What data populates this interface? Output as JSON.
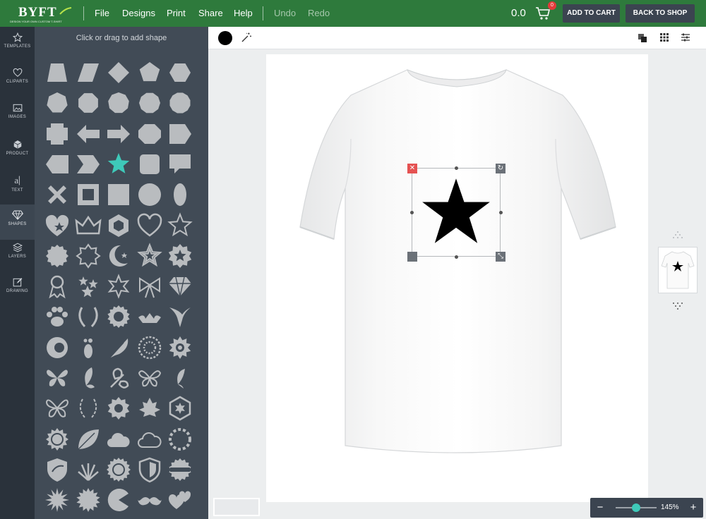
{
  "brand": {
    "name": "BYFT",
    "tagline": "DESIGN YOUR OWN CUSTOM T-SHIRT"
  },
  "menu": [
    "File",
    "Designs",
    "Print",
    "Share",
    "Help"
  ],
  "history": {
    "undo": "Undo",
    "redo": "Redo"
  },
  "cart": {
    "total": "0.0",
    "count": "0",
    "add_label": "ADD TO CART",
    "back_label": "BACK TO SHOP"
  },
  "sidebar": {
    "items": [
      {
        "label": "TEMPLATES",
        "icon": "star-outline-icon"
      },
      {
        "label": "CLIPARTS",
        "icon": "heart-icon"
      },
      {
        "label": "IMAGES",
        "icon": "image-icon"
      },
      {
        "label": "PRODUCT",
        "icon": "cube-icon"
      },
      {
        "label": "TEXT",
        "icon": "text-icon"
      },
      {
        "label": "SHAPES",
        "icon": "gem-icon",
        "active": true
      },
      {
        "label": "LAYERS",
        "icon": "layers-icon"
      },
      {
        "label": "DRAWING",
        "icon": "pencil-icon"
      }
    ]
  },
  "shapes": {
    "hint": "Click or drag to add shape",
    "items": [
      "trapezoid",
      "parallelogram",
      "diamond",
      "pentagon",
      "hexagon",
      "heptagon",
      "octagon",
      "nonagon",
      "decagon",
      "dodecagon",
      "cross",
      "arrow-left",
      "arrow-right",
      "octagon-wide",
      "pentagon-right",
      "chevron-left",
      "chevron-right",
      "star",
      "square-rounded",
      "speech-bubble",
      "x-mark",
      "square-frame",
      "square",
      "circle",
      "ellipse",
      "heart-star",
      "crown",
      "hexagon-ring",
      "heart-outline",
      "star-outline",
      "badge-scallop",
      "starburst-outline",
      "crescent-star",
      "star-outlined",
      "badge-star",
      "award-ribbon",
      "sparkles",
      "star-burst",
      "bow",
      "diamond-gem",
      "paw",
      "laurel-wreath",
      "rosette",
      "crown-wings",
      "eagle",
      "lion-head",
      "footprint",
      "feather",
      "mandala",
      "flower-swirl",
      "butterfly",
      "butterfly-side",
      "butterfly-flower",
      "butterfly-wings",
      "butterfly-small",
      "butterfly-outline",
      "laurel",
      "gear-flower",
      "maple-leaf",
      "hexagon-flower",
      "sun",
      "leaf",
      "cloud",
      "cloud-outline",
      "circle-flower",
      "eagle-shield",
      "grass",
      "medallion",
      "shield",
      "seal",
      "burst-spiky",
      "sun-burst",
      "pacman",
      "mustache",
      "hearts-pair"
    ],
    "highlight_color": "#3ec9b9",
    "shape_color": "#b9bcbf"
  },
  "toolbar": {
    "fill_color": "#000000"
  },
  "zoom": {
    "value": "145%",
    "minus": "−",
    "plus": "+"
  },
  "accent": "#2e7a3c",
  "dark": "#3b4450"
}
